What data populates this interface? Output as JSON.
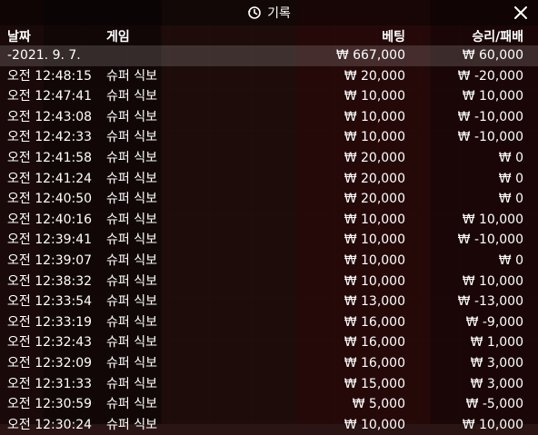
{
  "window": {
    "title": "기록",
    "title_icon": "history-icon",
    "close_icon": "close-icon"
  },
  "header": {
    "date": "날짜",
    "game": "게임",
    "bet": "베팅",
    "result": "승리/패배"
  },
  "date_group": {
    "date": "-2021. 9. 7.",
    "bet": "₩ 667,000",
    "result": "₩ 60,000"
  },
  "rows": [
    {
      "time": "오전 12:48:15",
      "game": "슈퍼 식보",
      "bet": "₩ 20,000",
      "result": "₩ -20,000"
    },
    {
      "time": "오전 12:47:41",
      "game": "슈퍼 식보",
      "bet": "₩ 10,000",
      "result": "₩ 10,000"
    },
    {
      "time": "오전 12:43:08",
      "game": "슈퍼 식보",
      "bet": "₩ 10,000",
      "result": "₩ -10,000"
    },
    {
      "time": "오전 12:42:33",
      "game": "슈퍼 식보",
      "bet": "₩ 10,000",
      "result": "₩ -10,000"
    },
    {
      "time": "오전 12:41:58",
      "game": "슈퍼 식보",
      "bet": "₩ 20,000",
      "result": "₩ 0"
    },
    {
      "time": "오전 12:41:24",
      "game": "슈퍼 식보",
      "bet": "₩ 20,000",
      "result": "₩ 0"
    },
    {
      "time": "오전 12:40:50",
      "game": "슈퍼 식보",
      "bet": "₩ 20,000",
      "result": "₩ 0"
    },
    {
      "time": "오전 12:40:16",
      "game": "슈퍼 식보",
      "bet": "₩ 10,000",
      "result": "₩ 10,000"
    },
    {
      "time": "오전 12:39:41",
      "game": "슈퍼 식보",
      "bet": "₩ 10,000",
      "result": "₩ -10,000"
    },
    {
      "time": "오전 12:39:07",
      "game": "슈퍼 식보",
      "bet": "₩ 10,000",
      "result": "₩ 0"
    },
    {
      "time": "오전 12:38:32",
      "game": "슈퍼 식보",
      "bet": "₩ 10,000",
      "result": "₩ 10,000"
    },
    {
      "time": "오전 12:33:54",
      "game": "슈퍼 식보",
      "bet": "₩ 13,000",
      "result": "₩ -13,000"
    },
    {
      "time": "오전 12:33:19",
      "game": "슈퍼 식보",
      "bet": "₩ 16,000",
      "result": "₩ -9,000"
    },
    {
      "time": "오전 12:32:43",
      "game": "슈퍼 식보",
      "bet": "₩ 16,000",
      "result": "₩ 1,000"
    },
    {
      "time": "오전 12:32:09",
      "game": "슈퍼 식보",
      "bet": "₩ 16,000",
      "result": "₩ 3,000"
    },
    {
      "time": "오전 12:31:33",
      "game": "슈퍼 식보",
      "bet": "₩ 15,000",
      "result": "₩ 3,000"
    },
    {
      "time": "오전 12:30:59",
      "game": "슈퍼 식보",
      "bet": "₩ 5,000",
      "result": "₩ -5,000"
    },
    {
      "time": "오전 12:30:24",
      "game": "슈퍼 식보",
      "bet": "₩ 10,000",
      "result": "₩ 10,000"
    }
  ]
}
